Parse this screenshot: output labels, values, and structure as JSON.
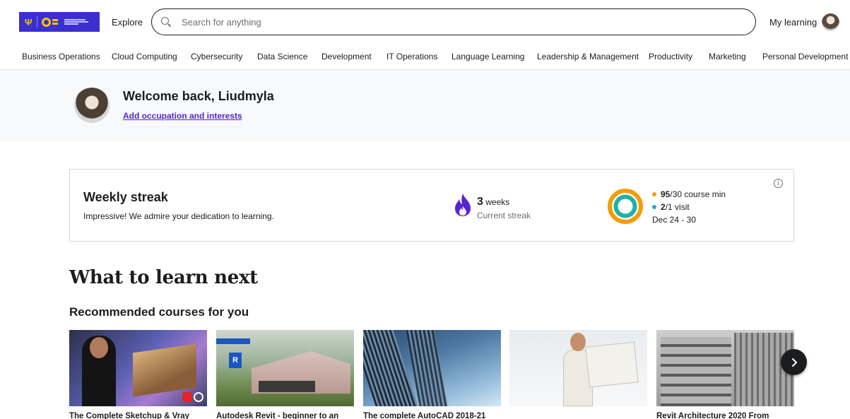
{
  "header": {
    "explore_label": "Explore",
    "search_placeholder": "Search for anything",
    "my_learning_label": "My learning"
  },
  "categories": [
    "Business Operations",
    "Cloud Computing",
    "Cybersecurity",
    "Data Science",
    "Development",
    "IT Operations",
    "Language Learning",
    "Leadership & Management",
    "Productivity",
    "Marketing",
    "Personal Development"
  ],
  "welcome": {
    "title": "Welcome back, Liudmyla",
    "link": "Add occupation and interests"
  },
  "streak": {
    "title": "Weekly streak",
    "subtitle": "Impressive! We admire your dedication to learning.",
    "weeks_count": "3",
    "weeks_unit": " weeks",
    "weeks_label": "Current streak",
    "minutes_value": "95",
    "minutes_rest": "/30 course min",
    "visits_value": "2",
    "visits_rest": "/1 visit",
    "dates": "Dec 24 - 30",
    "colors": {
      "minutes": "#f69c08",
      "visits": "#1eb2a6",
      "flame": "#5624d0"
    }
  },
  "learn": {
    "title": "What to learn next",
    "recommended_title": "Recommended courses for you"
  },
  "courses": [
    {
      "title": "The Complete Sketchup & Vray"
    },
    {
      "title": "Autodesk Revit - beginner to an"
    },
    {
      "title": "The complete AutoCAD 2018-21"
    },
    {
      "title": ""
    },
    {
      "title": "Revit Architecture 2020 From"
    }
  ],
  "accent_color": "#5624d0"
}
